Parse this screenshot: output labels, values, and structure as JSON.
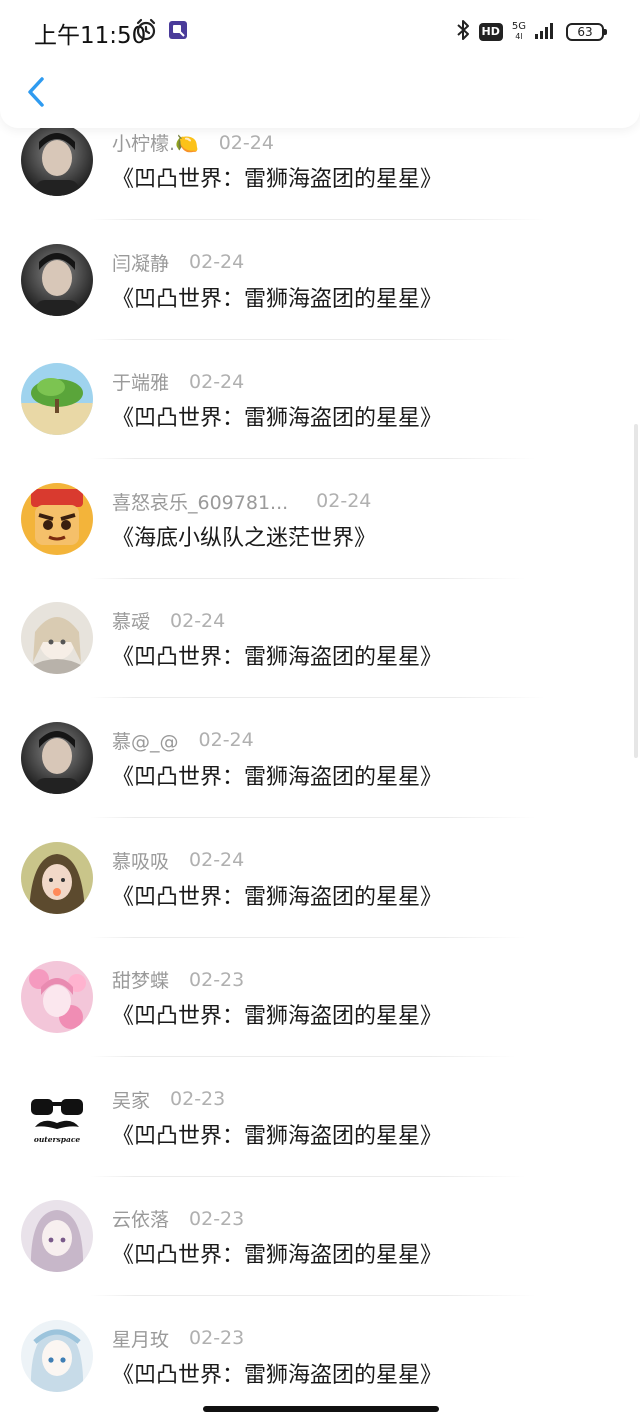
{
  "status_bar": {
    "time": "上午11:50",
    "left_icons": [
      "alarm-icon",
      "app-notification-icon"
    ],
    "right_icons": [
      "bluetooth-icon",
      "hd-badge",
      "5g-signal-icon",
      "battery-icon"
    ],
    "hd_label": "HD",
    "network_label": "5G",
    "network_sub": "4l",
    "battery_level": "63"
  },
  "header": {
    "back_icon": "chevron-left-icon",
    "accent_color": "#2f9bf0"
  },
  "items": [
    {
      "user": "小柠檬.🍋",
      "date": "02-24",
      "title": "《凹凸世界：雷狮海盗团的星星》",
      "avatar": "dark-portrait"
    },
    {
      "user": "闫凝静",
      "date": "02-24",
      "title": "《凹凸世界：雷狮海盗团的星星》",
      "avatar": "dark-portrait"
    },
    {
      "user": "于端雅",
      "date": "02-24",
      "title": "《凹凸世界：雷狮海盗团的星星》",
      "avatar": "landscape-tree"
    },
    {
      "user": "喜怒哀乐_609781...",
      "date": "02-24",
      "title": "《海底小纵队之迷茫世界》",
      "avatar": "cartoon-face"
    },
    {
      "user": "慕叆",
      "date": "02-24",
      "title": "《凹凸世界：雷狮海盗团的星星》",
      "avatar": "anime-white"
    },
    {
      "user": "慕@_@",
      "date": "02-24",
      "title": "《凹凸世界：雷狮海盗团的星星》",
      "avatar": "dark-portrait"
    },
    {
      "user": "慕吸吸",
      "date": "02-24",
      "title": "《凹凸世界：雷狮海盗团的星星》",
      "avatar": "girl-green"
    },
    {
      "user": "甜梦蝶",
      "date": "02-23",
      "title": "《凹凸世界：雷狮海盗团的星星》",
      "avatar": "anime-pink"
    },
    {
      "user": "吴家",
      "date": "02-23",
      "title": "《凹凸世界：雷狮海盗团的星星》",
      "avatar": "mustache-logo",
      "avatar_text": "outerspace"
    },
    {
      "user": "云依落",
      "date": "02-23",
      "title": "《凹凸世界：雷狮海盗团的星星》",
      "avatar": "anime-lilac"
    },
    {
      "user": "星月玫",
      "date": "02-23",
      "title": "《凹凸世界：雷狮海盗团的星星》",
      "avatar": "anime-blue"
    }
  ]
}
